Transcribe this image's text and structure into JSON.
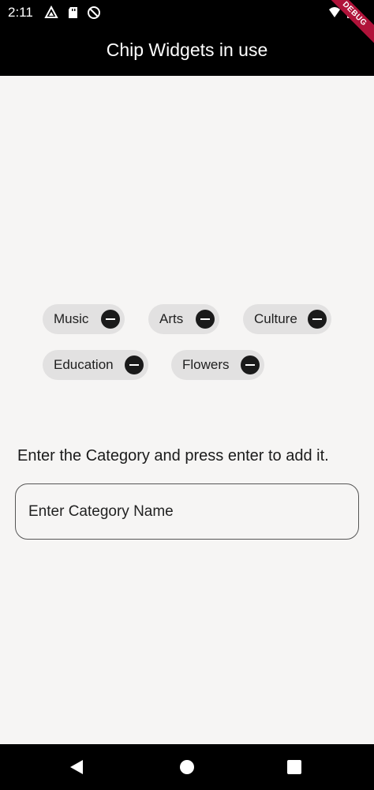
{
  "status_bar": {
    "time": "2:11",
    "left_icons": [
      "drive-icon",
      "sd-card-icon",
      "no-disturb-icon"
    ],
    "right_icons": [
      "wifi-icon",
      "battery-icon"
    ]
  },
  "app_bar": {
    "title": "Chip Widgets in use",
    "debug_banner": "DEBUG"
  },
  "chips": [
    {
      "label": "Music",
      "delete_icon": "remove-icon"
    },
    {
      "label": "Arts",
      "delete_icon": "remove-icon"
    },
    {
      "label": "Culture",
      "delete_icon": "remove-icon"
    },
    {
      "label": "Education",
      "delete_icon": "remove-icon"
    },
    {
      "label": "Flowers",
      "delete_icon": "remove-icon"
    }
  ],
  "form": {
    "prompt": "Enter the Category and press enter to add it.",
    "input_placeholder": "Enter Category Name",
    "input_value": ""
  },
  "nav_bar": {
    "icons": [
      "back-icon",
      "home-icon",
      "recents-icon"
    ]
  },
  "colors": {
    "background": "#f6f5f4",
    "bars": "#000000",
    "chip": "#e2e1e1",
    "debug_banner": "#b0133a"
  }
}
